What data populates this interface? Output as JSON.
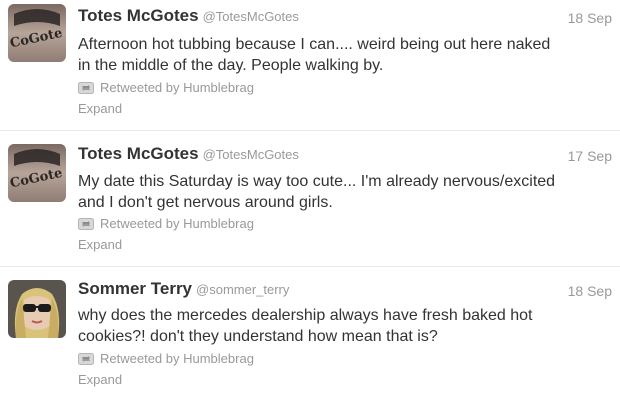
{
  "tweets": [
    {
      "name": "Totes McGotes",
      "handle": "@TotesMcGotes",
      "date": "18 Sep",
      "text_line1": "Afternoon hot tubbing because I can.... weird being out here naked",
      "text_line2": "in the middle of the day. People walking by.",
      "retweeted_by": "Retweeted by Humblebrag",
      "expand": "Expand",
      "avatar_text": "CoGote"
    },
    {
      "name": "Totes McGotes",
      "handle": "@TotesMcGotes",
      "date": "17 Sep",
      "text_line1": "My date this Saturday is way too cute... I'm already nervous/excited",
      "text_line2": "and I don't get nervous around girls.",
      "retweeted_by": "Retweeted by Humblebrag",
      "expand": "Expand",
      "avatar_text": "CoGote"
    },
    {
      "name": "Sommer Terry",
      "handle": "@sommer_terry",
      "date": "18 Sep",
      "text_line1": "why does the mercedes dealership always have fresh baked hot",
      "text_line2": "cookies?! don't they understand how mean that is?",
      "retweeted_by": "Retweeted by Humblebrag",
      "expand": "Expand"
    }
  ],
  "icons": {
    "retweet": "retweet-icon"
  },
  "colors": {
    "name": "#333333",
    "meta": "#999999",
    "divider": "#e8e8e8"
  }
}
